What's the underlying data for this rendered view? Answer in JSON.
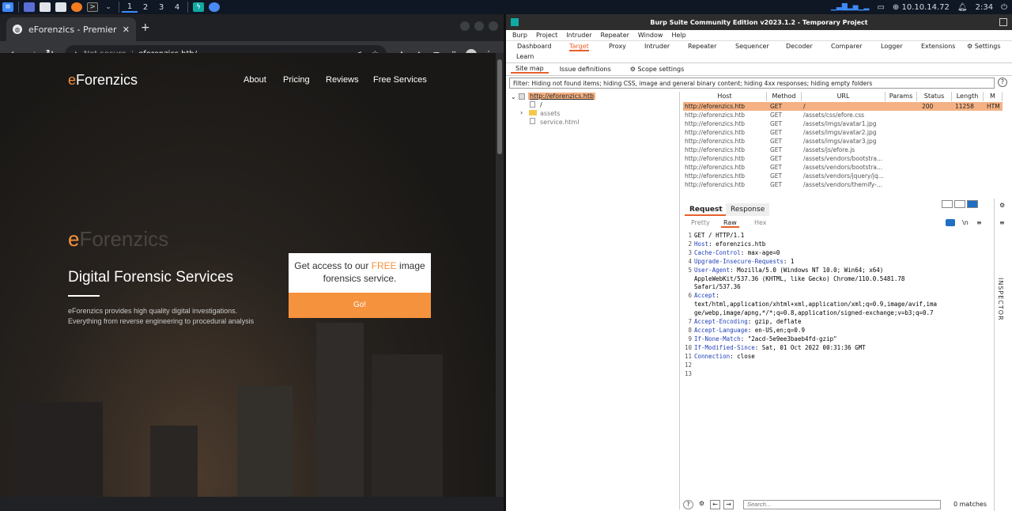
{
  "taskbar": {
    "workspaces": [
      "1",
      "2",
      "3",
      "4"
    ],
    "ip": "10.10.14.72",
    "time": "2:34"
  },
  "chrome": {
    "tab_title": "eForenzics - Premier Digi",
    "not_secure": "Not secure",
    "url": "eforenzics.htb/"
  },
  "site": {
    "logo_e": "e",
    "logo_rest": "Forenzics",
    "nav": [
      "About",
      "Pricing",
      "Reviews",
      "Free Services"
    ],
    "hero_logo_e": "e",
    "hero_logo_rest": "Forenzics",
    "hero_title": "Digital Forensic Services",
    "hero_desc_1": "eForenzics provides high quality digital investigations.",
    "hero_desc_2": "Everything from reverse engineering to procedural analysis",
    "card_pre": "Get access to our ",
    "card_free": "FREE",
    "card_post": " image forensics service.",
    "card_button": "Go!"
  },
  "burp": {
    "title": "Burp Suite Community Edition v2023.1.2 - Temporary Project",
    "menu": [
      "Burp",
      "Project",
      "Intruder",
      "Repeater",
      "Window",
      "Help"
    ],
    "tabs": [
      "Dashboard",
      "Target",
      "Proxy",
      "Intruder",
      "Repeater",
      "Sequencer",
      "Decoder",
      "Comparer",
      "Logger",
      "Extensions",
      "Settings",
      "Learn"
    ],
    "subtabs": [
      "Site map",
      "Issue definitions",
      "Scope settings"
    ],
    "filter": "Filter: Hiding not found items;  hiding CSS, image and general binary content;  hiding 4xx responses;  hiding empty folders",
    "tree": [
      "http://eforenzics.htb",
      "/",
      "assets",
      "service.html"
    ],
    "columns": [
      "Host",
      "Method",
      "URL",
      "Params",
      "Status",
      "Length",
      "M"
    ],
    "rows": [
      {
        "host": "http://eforenzics.htb",
        "method": "GET",
        "url": "/",
        "status": "200",
        "length": "11258",
        "m": "HTM"
      },
      {
        "host": "http://eforenzics.htb",
        "method": "GET",
        "url": "/assets/css/efore.css",
        "status": "",
        "length": "",
        "m": ""
      },
      {
        "host": "http://eforenzics.htb",
        "method": "GET",
        "url": "/assets/imgs/avatar1.jpg",
        "status": "",
        "length": "",
        "m": ""
      },
      {
        "host": "http://eforenzics.htb",
        "method": "GET",
        "url": "/assets/imgs/avatar2.jpg",
        "status": "",
        "length": "",
        "m": ""
      },
      {
        "host": "http://eforenzics.htb",
        "method": "GET",
        "url": "/assets/imgs/avatar3.jpg",
        "status": "",
        "length": "",
        "m": ""
      },
      {
        "host": "http://eforenzics.htb",
        "method": "GET",
        "url": "/assets/js/efore.js",
        "status": "",
        "length": "",
        "m": ""
      },
      {
        "host": "http://eforenzics.htb",
        "method": "GET",
        "url": "/assets/vendors/bootstra...",
        "status": "",
        "length": "",
        "m": ""
      },
      {
        "host": "http://eforenzics.htb",
        "method": "GET",
        "url": "/assets/vendors/bootstra...",
        "status": "",
        "length": "",
        "m": ""
      },
      {
        "host": "http://eforenzics.htb",
        "method": "GET",
        "url": "/assets/vendors/jquery/jq...",
        "status": "",
        "length": "",
        "m": ""
      },
      {
        "host": "http://eforenzics.htb",
        "method": "GET",
        "url": "/assets/vendors/themify-...",
        "status": "",
        "length": "",
        "m": ""
      }
    ],
    "req_tabs": [
      "Request",
      "Response"
    ],
    "req_subtabs": [
      "Pretty",
      "Raw",
      "Hex"
    ],
    "newline_btn": "\\n",
    "raw": [
      {
        "n": "1",
        "k": "",
        "v": "GET / HTTP/1.1"
      },
      {
        "n": "2",
        "k": "Host",
        "v": ": eforenzics.htb"
      },
      {
        "n": "3",
        "k": "Cache-Control",
        "v": ": max-age=0"
      },
      {
        "n": "4",
        "k": "Upgrade-Insecure-Requests",
        "v": ": 1"
      },
      {
        "n": "5",
        "k": "User-Agent",
        "v": ": Mozilla/5.0 (Windows NT 10.0; Win64; x64)"
      },
      {
        "n": "",
        "k": "",
        "v": "AppleWebKit/537.36 (KHTML, like Gecko) Chrome/110.0.5481.78"
      },
      {
        "n": "",
        "k": "",
        "v": "Safari/537.36"
      },
      {
        "n": "6",
        "k": "Accept",
        "v": ":"
      },
      {
        "n": "",
        "k": "",
        "v": "text/html,application/xhtml+xml,application/xml;q=0.9,image/avif,ima"
      },
      {
        "n": "",
        "k": "",
        "v": "ge/webp,image/apng,*/*;q=0.8,application/signed-exchange;v=b3;q=0.7"
      },
      {
        "n": "7",
        "k": "Accept-Encoding",
        "v": ": gzip, deflate"
      },
      {
        "n": "8",
        "k": "Accept-Language",
        "v": ": en-US,en;q=0.9"
      },
      {
        "n": "9",
        "k": "If-None-Match",
        "v": ": \"2acd-5e9ee3baeb4fd-gzip\""
      },
      {
        "n": "10",
        "k": "If-Modified-Since",
        "v": ": Sat, 01 Oct 2022 00:31:36 GMT"
      },
      {
        "n": "11",
        "k": "Connection",
        "v": ": close"
      },
      {
        "n": "12",
        "k": "",
        "v": ""
      },
      {
        "n": "13",
        "k": "",
        "v": ""
      }
    ],
    "inspector": "INSPECTOR",
    "search_placeholder": "Search...",
    "matches": "0 matches"
  },
  "colors": {
    "accent": "#f5923e",
    "burp_accent": "#e8602c",
    "selected_row": "#f4b183"
  }
}
